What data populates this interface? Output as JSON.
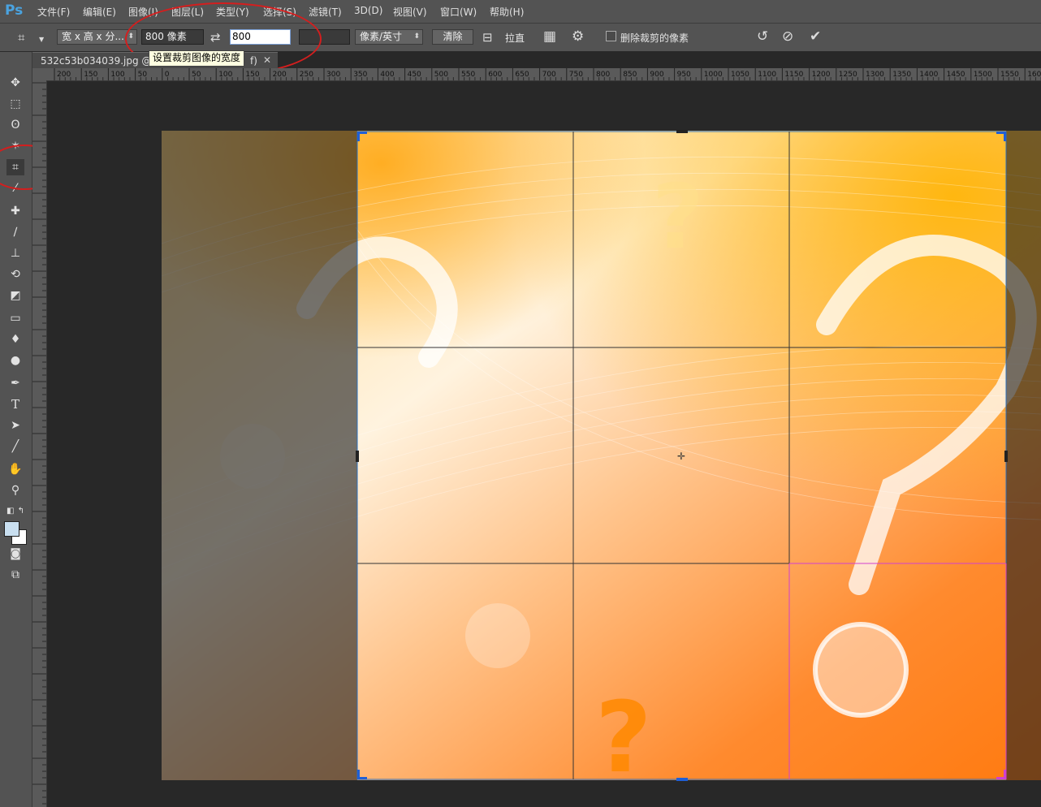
{
  "app": {
    "logo": "Ps"
  },
  "menu": [
    "文件(F)",
    "编辑(E)",
    "图像(I)",
    "图层(L)",
    "类型(Y)",
    "选择(S)",
    "滤镜(T)",
    "3D(D)",
    "视图(V)",
    "窗口(W)",
    "帮助(H)"
  ],
  "options": {
    "ratio_preset": "宽 x 高 x 分...",
    "width_value": "800 像素",
    "height_value": "800",
    "resolution_value": "",
    "unit": "像素/英寸",
    "clear_label": "清除",
    "straighten_label": "拉直",
    "delete_cropped_label": "删除裁剪的像素",
    "delete_cropped_checked": false
  },
  "document": {
    "tab_title": "532c53b034039.jpg @ 5",
    "tab_suffix": "f)"
  },
  "tooltip": "设置裁剪图像的宽度",
  "ruler": {
    "h_labels": [
      "200",
      "150",
      "100",
      "50",
      "0",
      "50",
      "100",
      "150",
      "200",
      "250",
      "300",
      "350",
      "400",
      "450",
      "500",
      "550",
      "600",
      "650",
      "700",
      "750",
      "800",
      "850",
      "900",
      "950",
      "1000",
      "1050",
      "1100",
      "1150",
      "1200",
      "1250",
      "1300",
      "1350",
      "1400",
      "1450",
      "1500",
      "1550",
      "160"
    ]
  },
  "tools": [
    "move-tool",
    "marquee-tool",
    "lasso-tool",
    "magic-wand-tool",
    "crop-tool",
    "eyedropper-tool",
    "healing-brush-tool",
    "brush-tool",
    "clone-stamp-tool",
    "history-brush-tool",
    "eraser-tool",
    "gradient-tool",
    "blur-tool",
    "dodge-tool",
    "pen-tool",
    "type-tool",
    "path-selection-tool",
    "line-tool",
    "hand-tool",
    "zoom-tool"
  ],
  "colors": {
    "foreground": "#c9dff0",
    "background": "#ffffff",
    "annotation": "#d41e1e",
    "crop_border": "#1f6fd6"
  }
}
